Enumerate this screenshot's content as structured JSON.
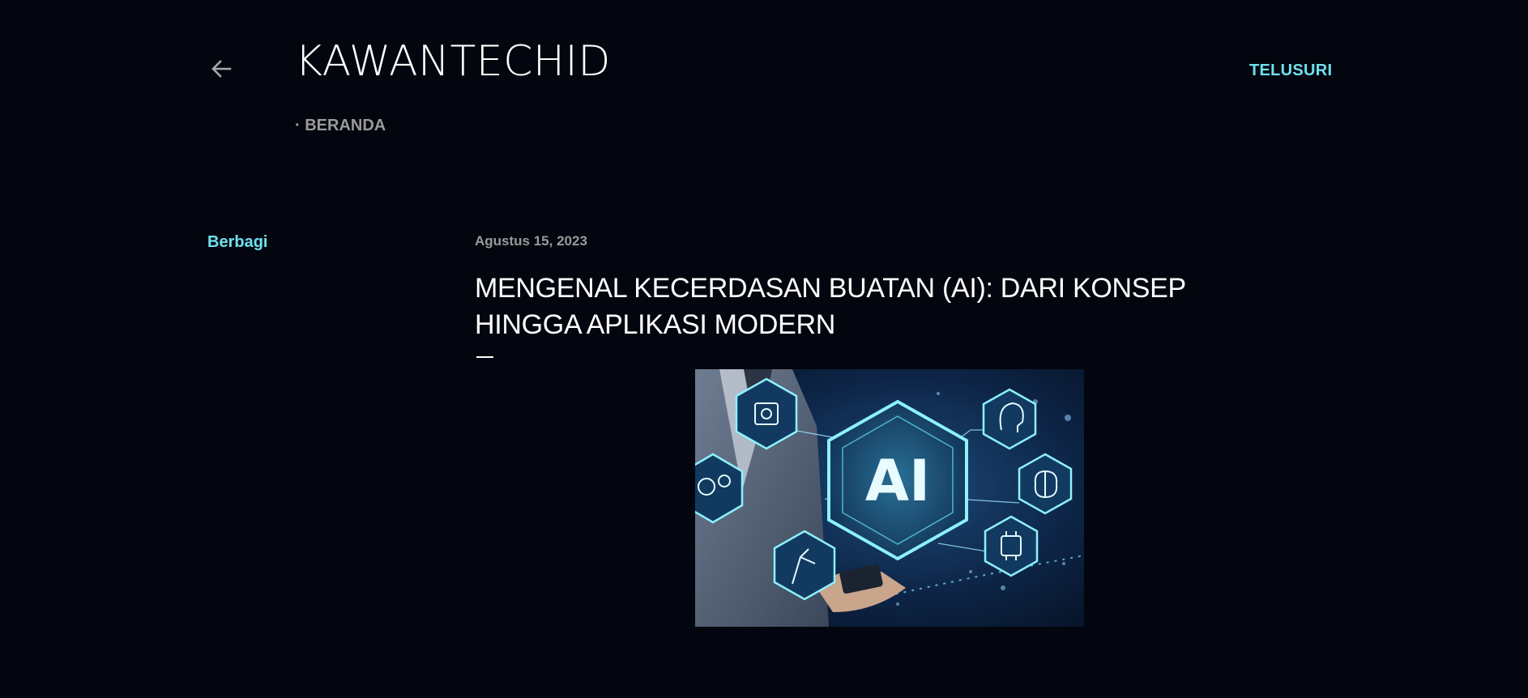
{
  "header": {
    "site_title": "KAWANTECHID",
    "search_label": "TELUSURI",
    "nav": [
      {
        "label": "· BERANDA"
      }
    ]
  },
  "sidebar": {
    "share_label": "Berbagi"
  },
  "post": {
    "date": "Agustus 15, 2023",
    "title": "MENGENAL KECERDASAN BUATAN (AI): DARI KONSEP HINGGA APLIKASI MODERN",
    "image": {
      "center_text": "AI",
      "icons": [
        "chip-icon",
        "gears-icon",
        "robot-arm-icon",
        "head-icon",
        "brain-icon",
        "cpu-icon"
      ]
    }
  },
  "colors": {
    "background": "#03060e",
    "accent": "#6fe0ef",
    "muted": "#9a9a9a",
    "text": "#ffffff"
  }
}
